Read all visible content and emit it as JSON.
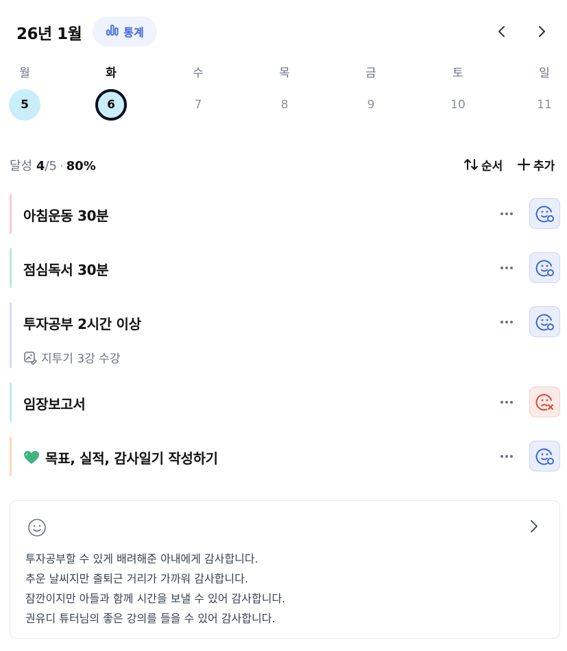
{
  "header": {
    "month_title": "26년 1월",
    "stats_label": "통계",
    "prev_icon": "chevron-left-icon",
    "next_icon": "chevron-right-icon"
  },
  "week": {
    "days": [
      {
        "name": "월",
        "num": "5",
        "state": "done"
      },
      {
        "name": "화",
        "num": "6",
        "state": "selected"
      },
      {
        "name": "수",
        "num": "7",
        "state": "none"
      },
      {
        "name": "목",
        "num": "8",
        "state": "none"
      },
      {
        "name": "금",
        "num": "9",
        "state": "none"
      },
      {
        "name": "토",
        "num": "10",
        "state": "none"
      },
      {
        "name": "일",
        "num": "11",
        "state": "none"
      }
    ]
  },
  "progress": {
    "label": "달성",
    "done": "4",
    "total": "/5",
    "separator": "·",
    "percent": "80%",
    "order_label": "순서",
    "add_label": "추가"
  },
  "tasks": [
    {
      "title": "아침운동 30분",
      "color": "#f9c7da",
      "status": "success",
      "note": ""
    },
    {
      "title": "점심독서 30분",
      "color": "#b9ebd6",
      "status": "success",
      "note": ""
    },
    {
      "title": "투자공부 2시간 이상",
      "color": "#d5dcf6",
      "status": "success",
      "note": "지투기 3강 수강"
    },
    {
      "title": "임장보고서",
      "color": "#bdeaf0",
      "status": "fail",
      "note": ""
    },
    {
      "title": "목표, 실적, 감사일기 작성하기",
      "color": "#fbd9b8",
      "status": "success",
      "note": "",
      "emoji": "💚"
    }
  ],
  "gratitude": {
    "icon": "smile-icon",
    "lines": [
      "투자공부할 수 있게 배려해준 아내에게 감사합니다.",
      "추운 날씨지만 출퇴근 거리가 가까워 감사합니다.",
      "잠깐이지만 아들과 함께 시간을 보낼 수 있어 감사합니다.",
      "권유디 튜터님의 좋은 강의를 들을 수 있어 감사합니다."
    ]
  },
  "colors": {
    "accent": "#3a63d8",
    "done_circle": "#c9eef7",
    "fail": "#d9472f"
  }
}
